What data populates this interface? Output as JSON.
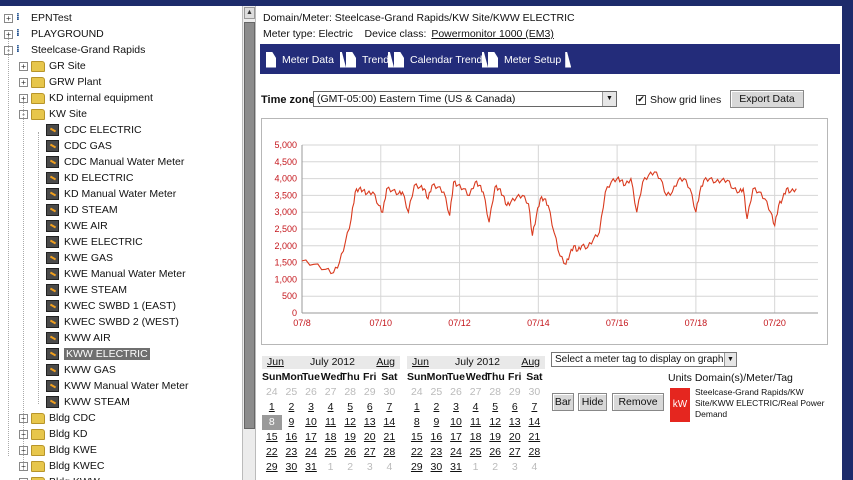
{
  "tree": {
    "items": [
      {
        "label": "EPNTest",
        "kind": "domain",
        "toggle": "+"
      },
      {
        "label": "PLAYGROUND",
        "kind": "domain",
        "toggle": "+"
      },
      {
        "label": "Steelcase-Grand Rapids",
        "kind": "domain",
        "toggle": "−"
      },
      {
        "label": "GR Site",
        "kind": "folder",
        "toggle": "+"
      },
      {
        "label": "GRW Plant",
        "kind": "folder",
        "toggle": "+"
      },
      {
        "label": "KD internal equipment",
        "kind": "folder",
        "toggle": "+"
      },
      {
        "label": "KW Site",
        "kind": "folder",
        "toggle": "−"
      },
      {
        "label": "CDC ELECTRIC",
        "kind": "meter"
      },
      {
        "label": "CDC GAS",
        "kind": "meter"
      },
      {
        "label": "CDC Manual Water Meter",
        "kind": "meter"
      },
      {
        "label": "KD ELECTRIC",
        "kind": "meter"
      },
      {
        "label": "KD Manual Water Meter",
        "kind": "meter"
      },
      {
        "label": "KD STEAM",
        "kind": "meter"
      },
      {
        "label": "KWE AIR",
        "kind": "meter"
      },
      {
        "label": "KWE ELECTRIC",
        "kind": "meter"
      },
      {
        "label": "KWE GAS",
        "kind": "meter"
      },
      {
        "label": "KWE Manual Water Meter",
        "kind": "meter"
      },
      {
        "label": "KWE STEAM",
        "kind": "meter"
      },
      {
        "label": "KWEC SWBD 1 (EAST)",
        "kind": "meter"
      },
      {
        "label": "KWEC SWBD 2 (WEST)",
        "kind": "meter"
      },
      {
        "label": "KWW AIR",
        "kind": "meter"
      },
      {
        "label": "KWW ELECTRIC",
        "kind": "meter",
        "selected": true
      },
      {
        "label": "KWW GAS",
        "kind": "meter"
      },
      {
        "label": "KWW Manual Water Meter",
        "kind": "meter"
      },
      {
        "label": "KWW STEAM",
        "kind": "meter"
      },
      {
        "label": "Bldg CDC",
        "kind": "folder",
        "toggle": "+"
      },
      {
        "label": "Bldg KD",
        "kind": "folder",
        "toggle": "+"
      },
      {
        "label": "Bldg KWE",
        "kind": "folder",
        "toggle": "+"
      },
      {
        "label": "Bldg KWEC",
        "kind": "folder",
        "toggle": "+"
      },
      {
        "label": "Bldg KWW",
        "kind": "folder",
        "toggle": "+"
      }
    ]
  },
  "header": {
    "domain_meter": "Domain/Meter: Steelcase-Grand Rapids/KW Site/KWW ELECTRIC",
    "meter_type": "Meter type: Electric",
    "device_class_label": "Device class:",
    "device_class_link": "Powermonitor 1000 (EM3)"
  },
  "tabs": [
    "Meter Data",
    "Trend",
    "Calendar Trend",
    "Meter Setup"
  ],
  "controls": {
    "timezone_label": "Time zone",
    "timezone_value": "(GMT-05:00) Eastern Time (US & Canada)",
    "grid_label": "Show grid lines",
    "grid_checked": "✔",
    "export_label": "Export Data"
  },
  "chart_data": {
    "type": "line",
    "title": "",
    "xlabel": "",
    "ylabel": "",
    "ylim": [
      0,
      5000
    ],
    "y_ticks": [
      "0",
      "500",
      "1,000",
      "1,500",
      "2,000",
      "2,500",
      "3,000",
      "3,500",
      "4,000",
      "4,500",
      "5,000"
    ],
    "x_ticks": [
      "07/8",
      "07/10",
      "07/12",
      "07/14",
      "07/16",
      "07/18",
      "07/20"
    ],
    "x_tick_day": [
      8,
      10,
      12,
      14,
      16,
      18,
      20
    ],
    "grid": true,
    "color": "#d93a1e",
    "series": [
      {
        "x": [
          8.0,
          8.3,
          8.6,
          8.8,
          8.95,
          9.1,
          9.25,
          9.35,
          9.45,
          9.55,
          9.65,
          9.8,
          9.95,
          10.05,
          10.15,
          10.3,
          10.45,
          10.55,
          10.7,
          10.85,
          11.0,
          11.1,
          11.2,
          11.3,
          11.45,
          11.6,
          11.75,
          11.85,
          11.95,
          12.1,
          12.25,
          12.4,
          12.5,
          12.6,
          12.75,
          12.9,
          13.0,
          13.1,
          13.2,
          13.3,
          13.45,
          13.6,
          13.75,
          13.85,
          13.95,
          14.05,
          14.15,
          14.25,
          14.4,
          14.55,
          14.7,
          14.8,
          14.9,
          15.0,
          15.1,
          15.25,
          15.4,
          15.55,
          15.7,
          15.85,
          16.0,
          16.1,
          16.2,
          16.35,
          16.5,
          16.65,
          16.8,
          16.95,
          17.1,
          17.25,
          17.4,
          17.55,
          17.7,
          17.85,
          18.0,
          18.1,
          18.2,
          18.35,
          18.5,
          18.65,
          18.8,
          18.95,
          19.1,
          19.2,
          19.3,
          19.45,
          19.6,
          19.75,
          19.9,
          20.0,
          20.1,
          20.2,
          20.3,
          20.4,
          20.55
        ],
        "y": [
          1550,
          1450,
          1300,
          1200,
          1500,
          2100,
          2800,
          3600,
          3700,
          3650,
          3550,
          3600,
          3200,
          3000,
          3700,
          3650,
          3550,
          3600,
          3000,
          3800,
          3750,
          3700,
          3400,
          3800,
          3750,
          3600,
          2900,
          3900,
          3800,
          3700,
          3500,
          3900,
          3800,
          3600,
          2700,
          3750,
          3700,
          3500,
          3200,
          3300,
          3450,
          3500,
          3250,
          2300,
          2900,
          3400,
          3400,
          3200,
          2400,
          1700,
          1450,
          1750,
          2000,
          1850,
          2000,
          1950,
          2200,
          2400,
          3600,
          3900,
          4000,
          3950,
          3800,
          4000,
          3000,
          3900,
          4100,
          4200,
          4000,
          3500,
          3600,
          3950,
          4000,
          3700,
          3000,
          3600,
          3950,
          4000,
          3900,
          3950,
          3950,
          3700,
          3600,
          3700,
          2800,
          3700,
          3600,
          3400,
          3000,
          2600,
          3200,
          3400,
          3700,
          3600,
          3700
        ]
      }
    ]
  },
  "calendars": [
    {
      "prev": "Jun",
      "title": "July 2012",
      "next": "Aug",
      "dow": [
        "Sun",
        "Mon",
        "Tue",
        "Wed",
        "Thu",
        "Fri",
        "Sat"
      ],
      "weeks": [
        [
          "24",
          "25",
          "26",
          "27",
          "28",
          "29",
          "30"
        ],
        [
          "1",
          "2",
          "3",
          "4",
          "5",
          "6",
          "7"
        ],
        [
          "8",
          "9",
          "10",
          "11",
          "12",
          "13",
          "14"
        ],
        [
          "15",
          "16",
          "17",
          "18",
          "19",
          "20",
          "21"
        ],
        [
          "22",
          "23",
          "24",
          "25",
          "26",
          "27",
          "28"
        ],
        [
          "29",
          "30",
          "31",
          "1",
          "2",
          "3",
          "4"
        ]
      ]
    },
    {
      "prev": "Jun",
      "title": "July 2012",
      "next": "Aug",
      "dow": [
        "Sun",
        "Mon",
        "Tue",
        "Wed",
        "Thu",
        "Fri",
        "Sat"
      ],
      "weeks": [
        [
          "24",
          "25",
          "26",
          "27",
          "28",
          "29",
          "30"
        ],
        [
          "1",
          "2",
          "3",
          "4",
          "5",
          "6",
          "7"
        ],
        [
          "8",
          "9",
          "10",
          "11",
          "12",
          "13",
          "14"
        ],
        [
          "15",
          "16",
          "17",
          "18",
          "19",
          "20",
          "21"
        ],
        [
          "22",
          "23",
          "24",
          "25",
          "26",
          "27",
          "28"
        ],
        [
          "29",
          "30",
          "31",
          "1",
          "2",
          "3",
          "4"
        ]
      ]
    }
  ],
  "meter_tags": {
    "select_placeholder": "Select a meter tag to display on graph:",
    "units_header": "Units Domain(s)/Meter/Tag",
    "bar_label": "Bar",
    "hide_label": "Hide",
    "remove_label": "Remove",
    "unit": "kW",
    "unit_color": "#e5261f",
    "tag_path": "Steelcase-Grand Rapids/KW Site/KWW ELECTRIC/Real Power Demand"
  }
}
